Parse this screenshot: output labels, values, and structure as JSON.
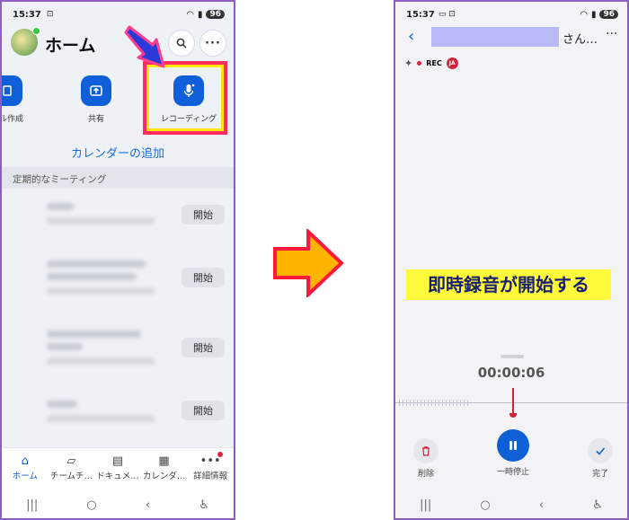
{
  "left_phone": {
    "status_bar": {
      "time": "15:37",
      "battery": "96"
    },
    "header": {
      "title": "ホーム"
    },
    "quick_actions": [
      {
        "label": "ール作成"
      },
      {
        "label": "共有"
      },
      {
        "label": "レコーディング"
      }
    ],
    "calendar_link": "カレンダーの追加",
    "section_title": "定期的なミーティング",
    "meetings": [
      {
        "start_label": "開始"
      },
      {
        "start_label": "開始"
      },
      {
        "start_label": "開始"
      },
      {
        "start_label": "開始"
      }
    ],
    "bottom_nav": [
      {
        "label": "ホーム"
      },
      {
        "label": "チームチ…"
      },
      {
        "label": "ドキュメ…"
      },
      {
        "label": "カレンダ…"
      },
      {
        "label": "詳細情報"
      }
    ]
  },
  "right_phone": {
    "status_bar": {
      "time": "15:37",
      "battery": "96"
    },
    "header": {
      "title": "さん…"
    },
    "rec_badge": "REC",
    "lang_badge": "JA",
    "timer": "00:00:06",
    "controls": {
      "delete_label": "削除",
      "pause_label": "一時停止",
      "done_label": "完了"
    }
  },
  "caption": "即時録音が開始する",
  "colors": {
    "accent": "#0e5fd8",
    "highlight_border": "#ff2c5d",
    "highlight_outline": "#ffe700",
    "caption_bg": "#fffb3a",
    "arrow_fill": "#ffb400",
    "arrow_stroke": "#ff1a3c"
  }
}
